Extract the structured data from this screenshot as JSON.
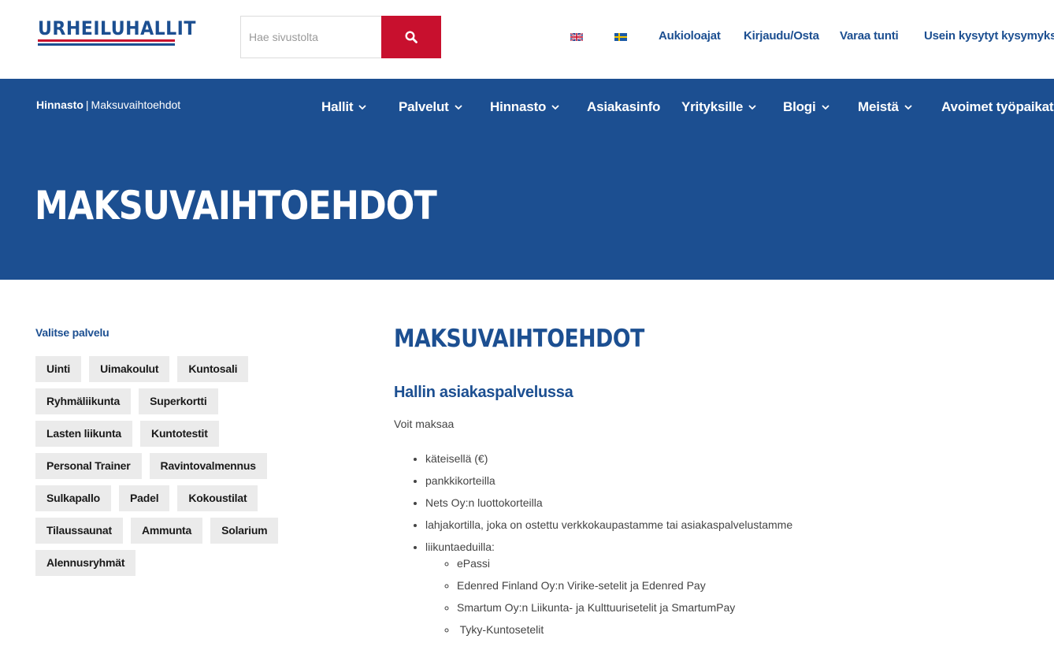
{
  "header": {
    "logo_text": "URHEILUHALLIT",
    "search": {
      "placeholder": "Hae sivustolta"
    },
    "flags": [
      "flag-uk-icon",
      "flag-sweden-icon"
    ],
    "links": [
      "Aukioloajat",
      "Kirjaudu/Osta",
      "Varaa tunti",
      "Usein kysytyt kysymykset"
    ]
  },
  "breadcrumb": {
    "parent": "Hinnasto",
    "separator": "|",
    "current": "Maksuvaihtoehdot"
  },
  "nav": [
    {
      "label": "Hallit",
      "dropdown": true
    },
    {
      "label": "Palvelut",
      "dropdown": true
    },
    {
      "label": "Hinnasto",
      "dropdown": true
    },
    {
      "label": "Asiakasinfo",
      "dropdown": false
    },
    {
      "label": "Yrityksille",
      "dropdown": true
    },
    {
      "label": "Blogi",
      "dropdown": true
    },
    {
      "label": "Meistä",
      "dropdown": true
    },
    {
      "label": "Avoimet työpaikat",
      "dropdown": false
    }
  ],
  "hero": {
    "title": "MAKSUVAIHTOEHDOT"
  },
  "sidebar": {
    "title": "Valitse palvelu",
    "tags": [
      "Uinti",
      "Uimakoulut",
      "Kuntosali",
      "Ryhmäliikunta",
      "Superkortti",
      "Lasten liikunta",
      "Kuntotestit",
      "Personal Trainer",
      "Ravintovalmennus",
      "Sulkapallo",
      "Padel",
      "Kokoustilat",
      "Tilaussaunat",
      "Ammunta",
      "Solarium",
      "Alennusryhmät"
    ]
  },
  "content": {
    "title": "MAKSUVAIHTOEHDOT",
    "subtitle": "Hallin asiakaspalvelussa",
    "intro": "Voit maksaa",
    "list": [
      "käteisellä (€)",
      "pankkikorteilla",
      "Nets Oy:n luottokorteilla",
      "lahjakortilla, joka on ostettu verkkokaupastamme tai asiakaspalvelustamme",
      "liikuntaeduilla:"
    ],
    "sublist": [
      "ePassi",
      "Edenred Finland Oy:n Virike-setelit ja Edenred Pay",
      "Smartum Oy:n Liikunta- ja Kulttuurisetelit ja SmartumPay",
      " Tyky-Kuntosetelit"
    ]
  },
  "colors": {
    "brand_blue": "#1c4f91",
    "brand_red": "#c8102e",
    "tag_bg": "#ebebeb"
  }
}
